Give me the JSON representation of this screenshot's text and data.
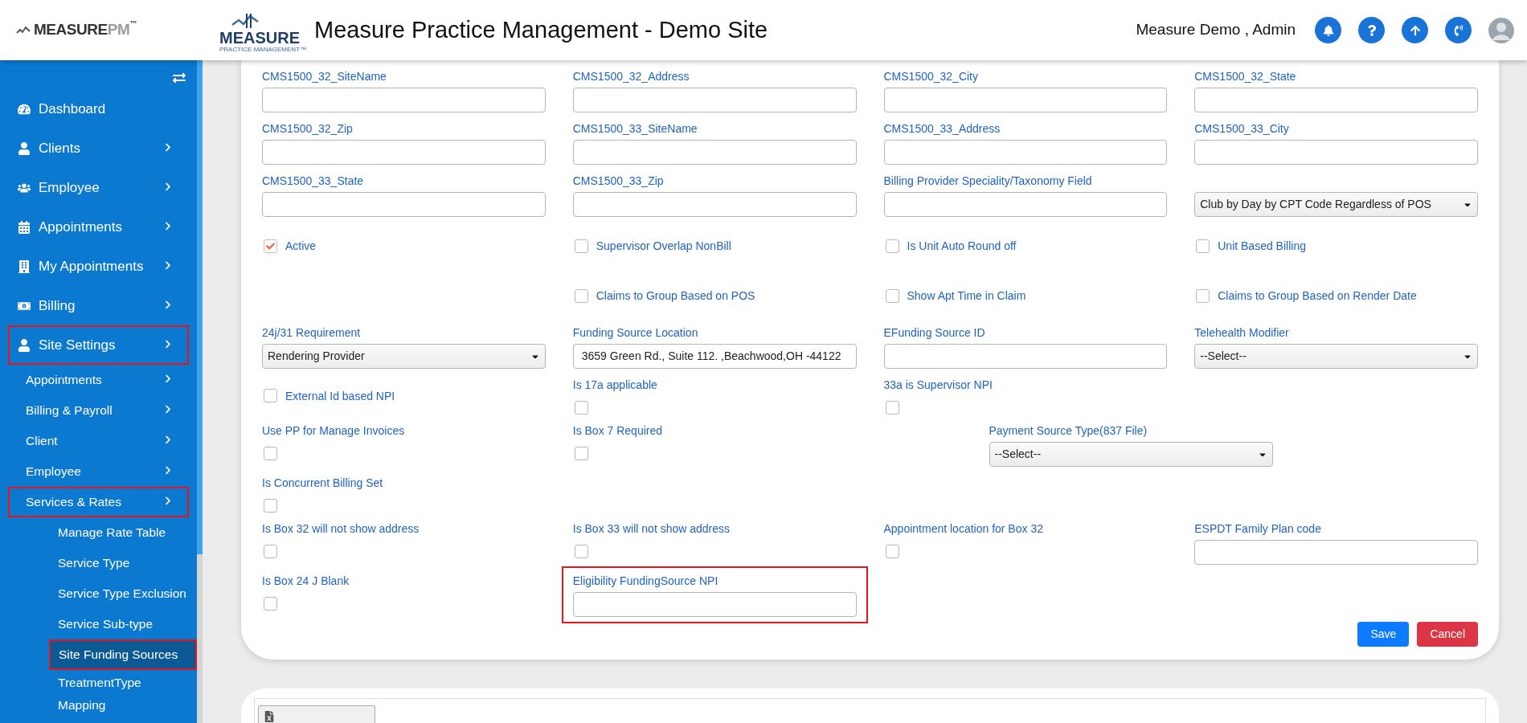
{
  "header": {
    "brand": {
      "main": "MEASURE",
      "suffix": "PM",
      "mark": "™"
    },
    "logo": {
      "name": "MEASURE",
      "tagline": "PRACTICE MANAGEMENT™"
    },
    "title": "Measure Practice Management - Demo Site",
    "user": "Measure Demo , Admin"
  },
  "sidebar": {
    "items": [
      {
        "label": "Dashboard",
        "has_submenu": false,
        "highlighted": false
      },
      {
        "label": "Clients",
        "has_submenu": true,
        "highlighted": false
      },
      {
        "label": "Employee",
        "has_submenu": true,
        "highlighted": false
      },
      {
        "label": "Appointments",
        "has_submenu": true,
        "highlighted": false
      },
      {
        "label": "My Appointments",
        "has_submenu": true,
        "highlighted": false
      },
      {
        "label": "Billing",
        "has_submenu": true,
        "highlighted": false
      },
      {
        "label": "Site Settings",
        "has_submenu": true,
        "highlighted": true,
        "children": [
          {
            "label": "Appointments",
            "has_submenu": true,
            "highlighted": false
          },
          {
            "label": "Billing & Payroll",
            "has_submenu": true,
            "highlighted": false
          },
          {
            "label": "Client",
            "has_submenu": true,
            "highlighted": false
          },
          {
            "label": "Employee",
            "has_submenu": true,
            "highlighted": false
          },
          {
            "label": "Services & Rates",
            "has_submenu": true,
            "highlighted": true,
            "children": [
              {
                "label": "Manage Rate Table",
                "selected": false,
                "highlighted": false
              },
              {
                "label": "Service Type",
                "selected": false,
                "highlighted": false
              },
              {
                "label": "Service Type Exclusion",
                "selected": false,
                "highlighted": false
              },
              {
                "label": "Service Sub-type",
                "selected": false,
                "highlighted": false
              },
              {
                "label": "Site Funding Sources",
                "selected": true,
                "highlighted": true
              },
              {
                "label": "TreatmentType Mapping",
                "selected": false,
                "highlighted": false
              }
            ]
          }
        ]
      }
    ]
  },
  "form": {
    "rows": [
      [
        {
          "kind": "field",
          "label": "CMS1500_32_SiteName"
        },
        {
          "kind": "field",
          "label": "CMS1500_32_Address"
        },
        {
          "kind": "field",
          "label": "CMS1500_32_City"
        },
        {
          "kind": "field",
          "label": "CMS1500_32_State"
        }
      ],
      [
        {
          "kind": "field",
          "label": "CMS1500_32_Zip"
        },
        {
          "kind": "field",
          "label": "CMS1500_33_SiteName"
        },
        {
          "kind": "field",
          "label": "CMS1500_33_Address"
        },
        {
          "kind": "field",
          "label": "CMS1500_33_City"
        }
      ],
      [
        {
          "kind": "field",
          "label": "CMS1500_33_State"
        },
        {
          "kind": "field",
          "label": "CMS1500_33_Zip"
        },
        {
          "kind": "field",
          "label": "Billing Provider Speciality/Taxonomy Field"
        },
        {
          "kind": "select",
          "value": "Club by Day by CPT Code Regardless of POS"
        }
      ],
      [
        {
          "kind": "check_inline",
          "label": "Active",
          "checked": true
        },
        {
          "kind": "check_inline",
          "label": "Supervisor Overlap NonBill",
          "checked": false
        },
        {
          "kind": "check_inline",
          "label": "Is Unit Auto Round off",
          "checked": false
        },
        {
          "kind": "check_inline",
          "label": "Unit Based Billing",
          "checked": false
        }
      ],
      [
        {
          "kind": "empty"
        },
        {
          "kind": "check_inline",
          "label": "Claims to Group Based on POS",
          "checked": false
        },
        {
          "kind": "check_inline",
          "label": "Show Apt Time in Claim",
          "checked": false
        },
        {
          "kind": "check_inline",
          "label": "Claims to Group Based on Render Date",
          "checked": false
        }
      ],
      [
        {
          "kind": "select",
          "label": "24j/31 Requirement",
          "value": "Rendering Provider"
        },
        {
          "kind": "field",
          "label": "Funding Source Location",
          "value": "3659 Green Rd., Suite 112. ,Beachwood,OH -44122"
        },
        {
          "kind": "field",
          "label": "EFunding Source ID"
        },
        {
          "kind": "select",
          "label": "Telehealth Modifier",
          "value": "--Select--"
        }
      ],
      [
        {
          "kind": "check_inline",
          "label": "External Id based NPI",
          "checked": false
        },
        {
          "kind": "check_below",
          "label": "Is 17a applicable",
          "checked": false
        },
        {
          "kind": "check_below",
          "label": "33a is Supervisor NPI",
          "checked": false
        },
        {
          "kind": "empty"
        }
      ],
      [
        {
          "kind": "check_below",
          "label": "Use PP for Manage Invoices",
          "checked": false
        },
        {
          "kind": "check_below",
          "label": "Is Box 7 Required",
          "checked": false
        },
        {
          "kind": "select_offset",
          "label": "Payment Source Type(837 File)",
          "value": "--Select--"
        },
        {
          "kind": "empty"
        }
      ],
      [
        {
          "kind": "check_below",
          "label": "Is Concurrent Billing Set",
          "checked": false
        },
        {
          "kind": "empty"
        },
        {
          "kind": "empty"
        },
        {
          "kind": "empty"
        }
      ],
      [
        {
          "kind": "check_below",
          "label": "Is Box 32 will not show address",
          "checked": false
        },
        {
          "kind": "check_below",
          "label": "Is Box 33 will not show address",
          "checked": false
        },
        {
          "kind": "check_below",
          "label": "Appointment location for Box 32",
          "checked": false
        },
        {
          "kind": "field",
          "label": "ESPDT Family Plan code"
        }
      ],
      [
        {
          "kind": "check_below",
          "label": "Is Box 24 J Blank",
          "checked": false
        },
        {
          "kind": "field",
          "label": "Eligibility FundingSource NPI",
          "highlighted": true
        },
        {
          "kind": "empty"
        },
        {
          "kind": "empty"
        }
      ]
    ],
    "buttons": [
      {
        "label": "Save",
        "kind": "primary"
      },
      {
        "label": "Cancel",
        "kind": "danger"
      }
    ]
  }
}
